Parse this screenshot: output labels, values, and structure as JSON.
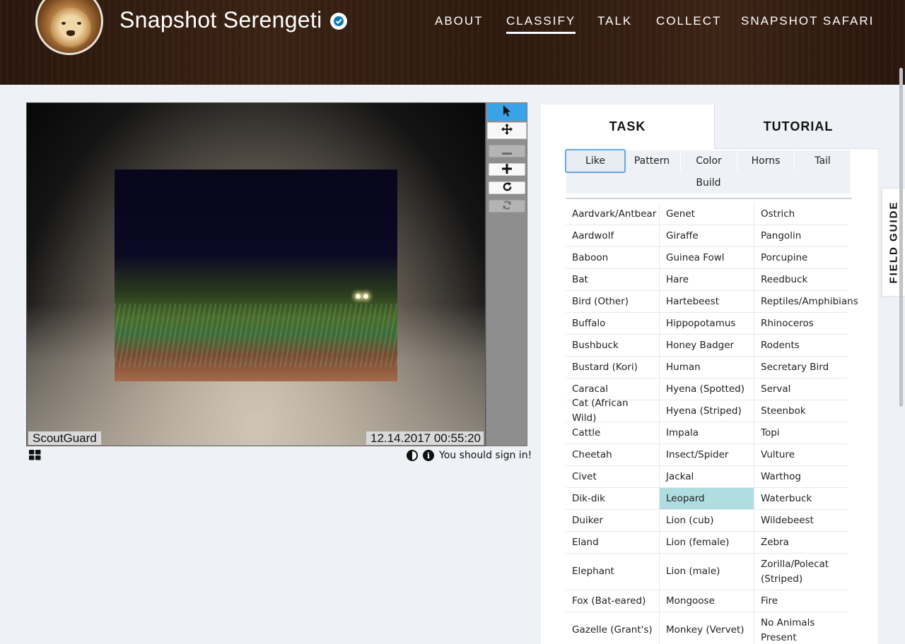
{
  "header": {
    "title": "Snapshot Serengeti",
    "nav": [
      {
        "label": "ABOUT",
        "active": false
      },
      {
        "label": "CLASSIFY",
        "active": true
      },
      {
        "label": "TALK",
        "active": false
      },
      {
        "label": "COLLECT",
        "active": false
      },
      {
        "label": "SNAPSHOT SAFARI",
        "active": false
      }
    ]
  },
  "viewer": {
    "brand_caption": "ScoutGuard",
    "timestamp_caption": "12.14.2017 00:55:20",
    "tools": [
      {
        "icon": "pointer-icon",
        "active": true
      },
      {
        "icon": "move-icon",
        "active": false
      },
      {
        "icon": "zoom-out-icon",
        "disabled": true
      },
      {
        "icon": "zoom-in-icon",
        "disabled": false
      },
      {
        "icon": "rotate-icon",
        "disabled": false
      },
      {
        "icon": "reset-icon",
        "disabled": true
      }
    ],
    "signin_text": "You should sign in!"
  },
  "panel": {
    "tabs": [
      {
        "label": "TASK",
        "active": true
      },
      {
        "label": "TUTORIAL",
        "active": false
      }
    ],
    "filters": [
      "Like",
      "Pattern",
      "Color",
      "Horns",
      "Tail",
      "Build"
    ],
    "active_filter": "Like",
    "selected_species": "Leopard",
    "species_columns": [
      [
        "Aardvark/Antbear",
        "Aardwolf",
        "Baboon",
        "Bat",
        "Bird (Other)",
        "Buffalo",
        "Bushbuck",
        "Bustard (Kori)",
        "Caracal",
        "Cat (African Wild)",
        "Cattle",
        "Cheetah",
        "Civet",
        "Dik-dik",
        "Duiker",
        "Eland",
        "Elephant",
        "Fox (Bat-eared)",
        "Gazelle (Grant's)"
      ],
      [
        "Genet",
        "Giraffe",
        "Guinea Fowl",
        "Hare",
        "Hartebeest",
        "Hippopotamus",
        "Honey Badger",
        "Human",
        "Hyena (Spotted)",
        "Hyena (Striped)",
        "Impala",
        "Insect/Spider",
        "Jackal",
        "Leopard",
        "Lion (cub)",
        "Lion (female)",
        "Lion (male)",
        "Mongoose",
        "Monkey (Vervet)"
      ],
      [
        "Ostrich",
        "Pangolin",
        "Porcupine",
        "Reedbuck",
        "Reptiles/Amphibians",
        "Rhinoceros",
        "Rodents",
        "Secretary Bird",
        "Serval",
        "Steenbok",
        "Topi",
        "Vulture",
        "Warthog",
        "Waterbuck",
        "Wildebeest",
        "Zebra",
        "Zorilla/Polecat (Striped)",
        "Fire",
        "No Animals Present"
      ]
    ]
  },
  "field_guide": {
    "label": "FIELD GUIDE"
  },
  "colors": {
    "accent": "#3aa3e8",
    "selected": "#b0dde0",
    "header": "#2f1a0e"
  }
}
